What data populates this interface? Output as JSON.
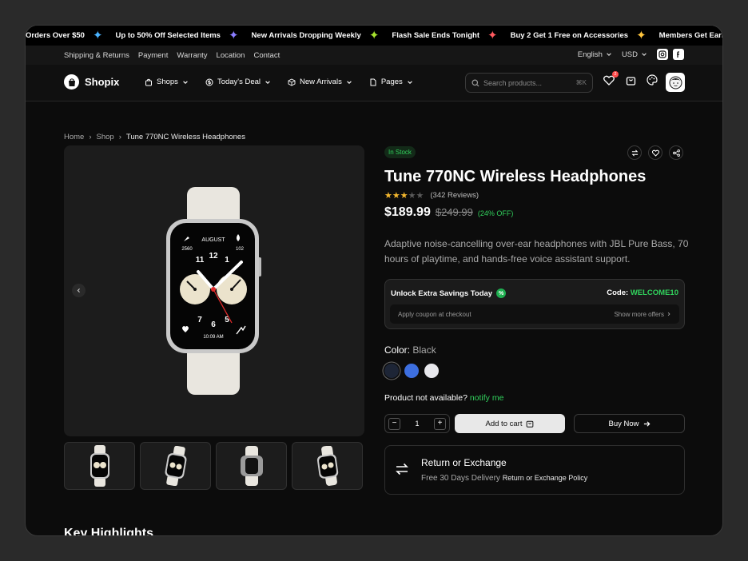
{
  "ticker": [
    {
      "text": "Orders Over $50",
      "star_color": "#4ab3ff"
    },
    {
      "text": "Up to 50% Off Selected Items",
      "star_color": "#8a7dff"
    },
    {
      "text": "New Arrivals Dropping Weekly",
      "star_color": "#a6e22e"
    },
    {
      "text": "Flash Sale Ends Tonight",
      "star_color": "#ff5a5f"
    },
    {
      "text": "Buy 2 Get 1 Free on Accessories",
      "star_color": "#ffc53d"
    },
    {
      "text": "Members Get Early Access",
      "star_color": "#4ab3ff"
    }
  ],
  "topbar": {
    "links": [
      "Shipping & Returns",
      "Payment",
      "Warranty",
      "Location",
      "Contact"
    ],
    "language": "English",
    "currency": "USD"
  },
  "nav": {
    "brand": "Shopix",
    "menu": [
      {
        "label": "Shops",
        "icon": "bag-icon"
      },
      {
        "label": "Today's Deal",
        "icon": "dollar-icon"
      },
      {
        "label": "New Arrivals",
        "icon": "box-icon"
      },
      {
        "label": "Pages",
        "icon": "page-icon"
      }
    ],
    "search_placeholder": "Search products...",
    "search_shortcut": "⌘K",
    "wishlist_count": "2"
  },
  "breadcrumb": [
    "Home",
    "Shop",
    "Tune 770NC Wireless Headphones"
  ],
  "product": {
    "stock": "In Stock",
    "title": "Tune 770NC Wireless Headphones",
    "rating": 3,
    "rating_max": 5,
    "reviews": "(342 Reviews)",
    "price": "$189.99",
    "old_price": "$249.99",
    "discount": "(24% OFF)",
    "description": "Adaptive noise-cancelling over-ear headphones with JBL Pure Bass, 70 hours of playtime, and hands-free voice assistant support.",
    "watch": {
      "month": "AUGUST",
      "left_num": "2560",
      "right_num": "102",
      "time": "10:09 AM"
    }
  },
  "coupon": {
    "heading": "Unlock Extra Savings Today",
    "code_label": "Code:",
    "code": "WELCOME10",
    "hint": "Apply coupon at checkout",
    "more": "Show more offers"
  },
  "colors": {
    "label": "Color:",
    "selected": "Black",
    "swatches": [
      "#1d2536",
      "#3d6fe0",
      "#e8e8ec"
    ]
  },
  "availability": {
    "text": "Product not available?",
    "link": "notify me"
  },
  "cart": {
    "qty": "1",
    "add_label": "Add to cart",
    "buy_label": "Buy Now"
  },
  "returns": {
    "title": "Return or Exchange",
    "subtitle": "Free 30 Days Delivery",
    "link": "Return or Exchange Policy"
  },
  "highlights_heading": "Key Highlights",
  "colors_theme": {
    "accent_green": "#31d15c"
  }
}
